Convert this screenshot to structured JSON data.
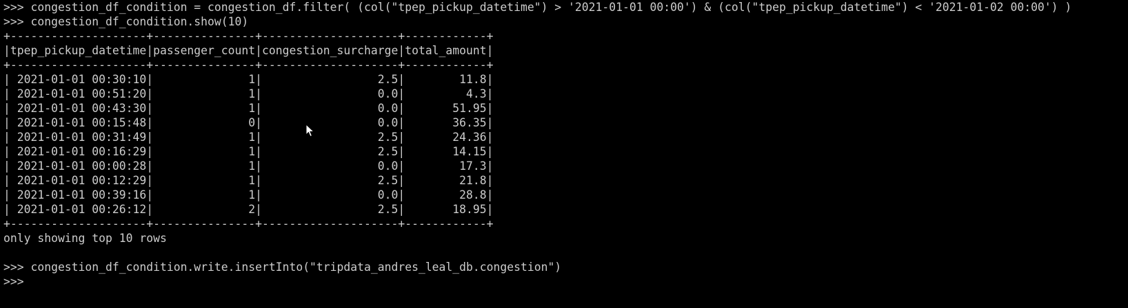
{
  "terminal": {
    "lines": [
      ">>> congestion_df_condition = congestion_df.filter( (col(\"tpep_pickup_datetime\") > '2021-01-01 00:00') & (col(\"tpep_pickup_datetime\") < '2021-01-02 00:00') )",
      ">>> congestion_df_condition.show(10)",
      "+--------------------+---------------+--------------------+------------+",
      "|tpep_pickup_datetime|passenger_count|congestion_surcharge|total_amount|",
      "+--------------------+---------------+--------------------+------------+",
      "| 2021-01-01 00:30:10|              1|                 2.5|        11.8|",
      "| 2021-01-01 00:51:20|              1|                 0.0|         4.3|",
      "| 2021-01-01 00:43:30|              1|                 0.0|       51.95|",
      "| 2021-01-01 00:15:48|              0|                 0.0|       36.35|",
      "| 2021-01-01 00:31:49|              1|                 2.5|       24.36|",
      "| 2021-01-01 00:16:29|              1|                 2.5|       14.15|",
      "| 2021-01-01 00:00:28|              1|                 0.0|        17.3|",
      "| 2021-01-01 00:12:29|              1|                 2.5|        21.8|",
      "| 2021-01-01 00:39:16|              1|                 0.0|        28.8|",
      "| 2021-01-01 00:26:12|              2|                 2.5|       18.95|",
      "+--------------------+---------------+--------------------+------------+",
      "only showing top 10 rows",
      "",
      ">>> congestion_df_condition.write.insertInto(\"tripdata_andres_leal_db.congestion\")",
      ">>>"
    ]
  },
  "colors": {
    "background": "#000000",
    "foreground": "#cccccc",
    "cursor": "#ffffff"
  },
  "icons": {
    "mouse_pointer": "arrow-cursor-icon"
  }
}
